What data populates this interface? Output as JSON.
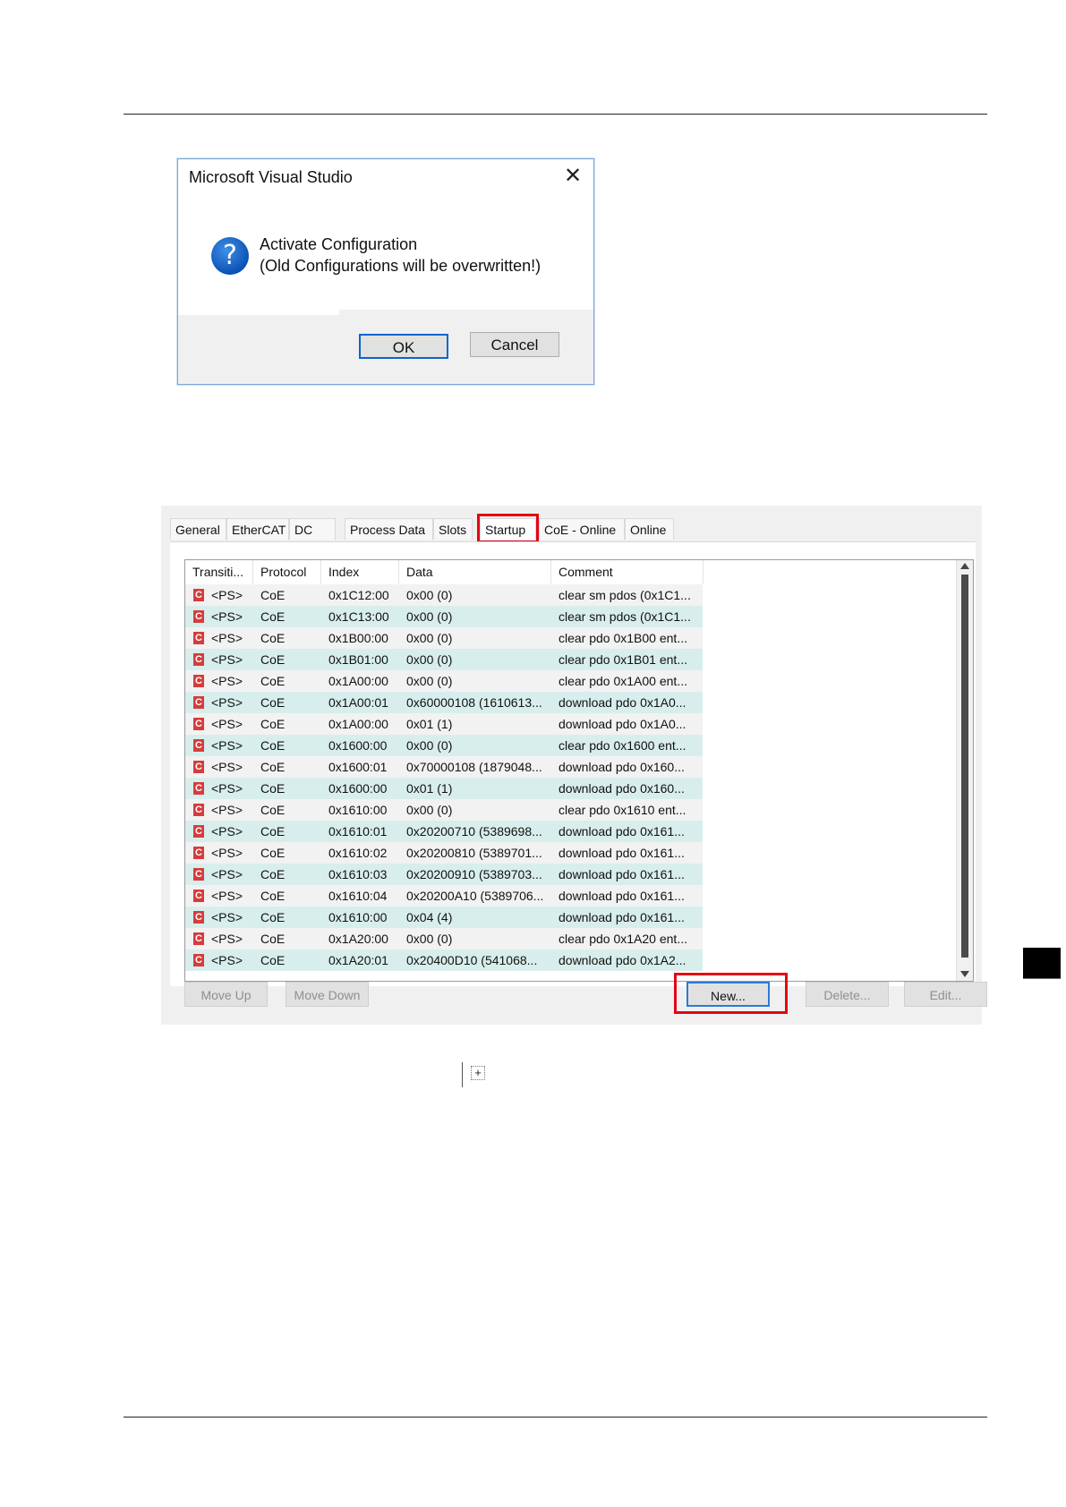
{
  "dialog": {
    "title": "Microsoft Visual Studio",
    "close_icon": "close-icon",
    "icon": "question-icon",
    "message_line1": "Activate Configuration",
    "message_line2": "(Old Configurations will be overwritten!)",
    "ok_label": "OK",
    "cancel_label": "Cancel"
  },
  "tabs": [
    "General",
    "EtherCAT",
    "DC",
    "Process Data",
    "Slots",
    "Startup",
    "CoE - Online",
    "Online"
  ],
  "active_tab": "Startup",
  "highlight_color": "#e30613",
  "table": {
    "columns": [
      "Transiti...",
      "Protocol",
      "Index",
      "Data",
      "Comment"
    ],
    "rows": [
      {
        "transition": "<PS>",
        "protocol": "CoE",
        "index": "0x1C12:00",
        "data": "0x00 (0)",
        "comment": "clear sm pdos (0x1C1..."
      },
      {
        "transition": "<PS>",
        "protocol": "CoE",
        "index": "0x1C13:00",
        "data": "0x00 (0)",
        "comment": "clear sm pdos (0x1C1..."
      },
      {
        "transition": "<PS>",
        "protocol": "CoE",
        "index": "0x1B00:00",
        "data": "0x00 (0)",
        "comment": "clear pdo 0x1B00 ent..."
      },
      {
        "transition": "<PS>",
        "protocol": "CoE",
        "index": "0x1B01:00",
        "data": "0x00 (0)",
        "comment": "clear pdo 0x1B01 ent..."
      },
      {
        "transition": "<PS>",
        "protocol": "CoE",
        "index": "0x1A00:00",
        "data": "0x00 (0)",
        "comment": "clear pdo 0x1A00 ent..."
      },
      {
        "transition": "<PS>",
        "protocol": "CoE",
        "index": "0x1A00:01",
        "data": "0x60000108 (1610613...",
        "comment": "download pdo 0x1A0..."
      },
      {
        "transition": "<PS>",
        "protocol": "CoE",
        "index": "0x1A00:00",
        "data": "0x01 (1)",
        "comment": "download pdo 0x1A0..."
      },
      {
        "transition": "<PS>",
        "protocol": "CoE",
        "index": "0x1600:00",
        "data": "0x00 (0)",
        "comment": "clear pdo 0x1600 ent..."
      },
      {
        "transition": "<PS>",
        "protocol": "CoE",
        "index": "0x1600:01",
        "data": "0x70000108 (1879048...",
        "comment": "download pdo 0x160..."
      },
      {
        "transition": "<PS>",
        "protocol": "CoE",
        "index": "0x1600:00",
        "data": "0x01 (1)",
        "comment": "download pdo 0x160..."
      },
      {
        "transition": "<PS>",
        "protocol": "CoE",
        "index": "0x1610:00",
        "data": "0x00 (0)",
        "comment": "clear pdo 0x1610 ent..."
      },
      {
        "transition": "<PS>",
        "protocol": "CoE",
        "index": "0x1610:01",
        "data": "0x20200710 (5389698...",
        "comment": "download pdo 0x161..."
      },
      {
        "transition": "<PS>",
        "protocol": "CoE",
        "index": "0x1610:02",
        "data": "0x20200810 (5389701...",
        "comment": "download pdo 0x161..."
      },
      {
        "transition": "<PS>",
        "protocol": "CoE",
        "index": "0x1610:03",
        "data": "0x20200910 (5389703...",
        "comment": "download pdo 0x161..."
      },
      {
        "transition": "<PS>",
        "protocol": "CoE",
        "index": "0x1610:04",
        "data": "0x20200A10 (5389706...",
        "comment": "download pdo 0x161..."
      },
      {
        "transition": "<PS>",
        "protocol": "CoE",
        "index": "0x1610:00",
        "data": "0x04 (4)",
        "comment": "download pdo 0x161..."
      },
      {
        "transition": "<PS>",
        "protocol": "CoE",
        "index": "0x1A20:00",
        "data": "0x00 (0)",
        "comment": "clear pdo 0x1A20 ent..."
      },
      {
        "transition": "<PS>",
        "protocol": "CoE",
        "index": "0x1A20:01",
        "data": "0x20400D10 (541068...",
        "comment": "download pdo 0x1A2..."
      }
    ]
  },
  "buttons": {
    "move_up": "Move Up",
    "move_down": "Move Down",
    "new": "New...",
    "delete": "Delete...",
    "edit": "Edit..."
  }
}
